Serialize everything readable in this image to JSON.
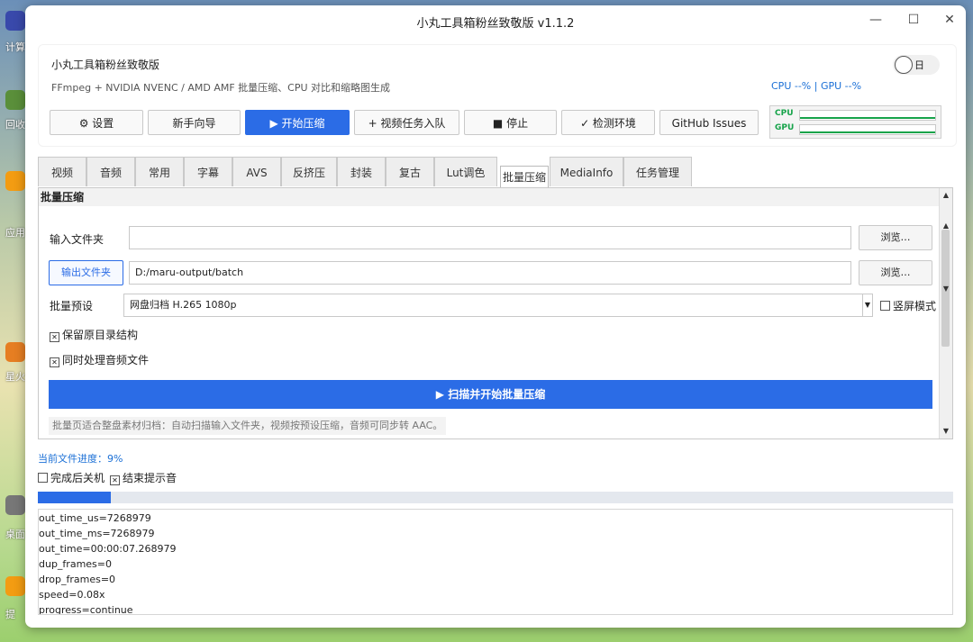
{
  "desktop": {
    "icons": [
      {
        "label": "计算",
        "color": "#3949ab"
      },
      {
        "label": "回收",
        "color": "#5a8f3a"
      },
      {
        "label": "应用",
        "color": "#f39c12"
      },
      {
        "label": "星火",
        "color": "#e67e22"
      },
      {
        "label": "桌面",
        "color": "#777777"
      },
      {
        "label": "提",
        "color": "#f39c12"
      }
    ]
  },
  "window": {
    "title": "小丸工具箱粉丝致敬版 v1.1.2",
    "controls": {
      "minimize": "—",
      "maximize": "☐",
      "close": "✕"
    }
  },
  "header": {
    "app_name": "小丸工具箱粉丝致敬版",
    "subtitle": "FFmpeg + NVIDIA NVENC / AMD AMF 批量压缩、CPU 对比和缩略图生成",
    "theme_toggle_label": "日",
    "usage": "CPU --% | GPU --%",
    "meters": {
      "cpu_label": "CPU",
      "gpu_label": "GPU"
    }
  },
  "toolbar": {
    "settings": "⚙ 设置",
    "guide": "新手向导",
    "start": "▶ 开始压缩",
    "enqueue": "+ 视频任务入队",
    "stop": "■ 停止",
    "check_env": "✓ 检测环境",
    "issues": "GitHub Issues"
  },
  "tabs": [
    "视频",
    "音频",
    "常用",
    "字幕",
    "AVS",
    "反挤压",
    "封装",
    "复古",
    "Lut调色",
    "批量压缩",
    "MediaInfo",
    "任务管理"
  ],
  "active_tab": "批量压缩",
  "batch": {
    "panel_title": "批量压缩",
    "input_label": "输入文件夹",
    "input_value": "",
    "browse": "浏览…",
    "output_button": "输出文件夹",
    "output_value": "D:/maru-output/batch",
    "preset_label": "批量预设",
    "preset_value": "网盘归档 H.265 1080p",
    "vertical_label": "竖屏模式",
    "keep_structure": "保留原目录结构",
    "process_audio": "同时处理音频文件",
    "scan_start": "▶ 扫描并开始批量压缩",
    "hint": "批量页适合整盘素材归档：自动扫描输入文件夹，视频按预设压缩，音频可同步转 AAC。"
  },
  "progress": {
    "label": "当前文件进度：9%",
    "fraction": 0.08,
    "shutdown": "完成后关机",
    "beep": "结束提示音"
  },
  "log": [
    "out_time_us=7268979",
    "out_time_ms=7268979",
    "out_time=00:00:07.268979",
    "dup_frames=0",
    "drop_frames=0",
    "speed=0.08x",
    "progress=continue"
  ],
  "colors": {
    "accent": "#2b6ce6",
    "meter": "#16a34a",
    "link": "#1a6fd6"
  }
}
